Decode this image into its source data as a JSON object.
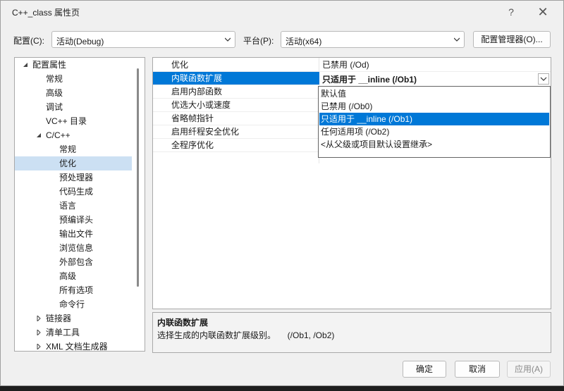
{
  "window": {
    "title": "C++_class 属性页",
    "help_glyph": "?",
    "close_glyph": "✕"
  },
  "toolbar": {
    "config_label": "配置(C):",
    "config_value": "活动(Debug)",
    "platform_label": "平台(P):",
    "platform_value": "活动(x64)",
    "config_manager_label": "配置管理器(O)..."
  },
  "tree": {
    "items": [
      {
        "label": "配置属性",
        "expander": "expanded"
      },
      {
        "label": "常规"
      },
      {
        "label": "高级"
      },
      {
        "label": "调试"
      },
      {
        "label": "VC++ 目录"
      },
      {
        "label": "C/C++",
        "expander": "expanded"
      },
      {
        "label": "常规"
      },
      {
        "label": "优化",
        "selected": true
      },
      {
        "label": "预处理器"
      },
      {
        "label": "代码生成"
      },
      {
        "label": "语言"
      },
      {
        "label": "预编译头"
      },
      {
        "label": "输出文件"
      },
      {
        "label": "浏览信息"
      },
      {
        "label": "外部包含"
      },
      {
        "label": "高级"
      },
      {
        "label": "所有选项"
      },
      {
        "label": "命令行"
      },
      {
        "label": "链接器",
        "expander": "collapsed"
      },
      {
        "label": "清单工具",
        "expander": "collapsed"
      },
      {
        "label": "XML 文档生成器",
        "expander": "collapsed"
      }
    ]
  },
  "properties": {
    "rows": [
      {
        "name": "优化",
        "value": "已禁用 (/Od)"
      },
      {
        "name": "内联函数扩展",
        "value": "只适用于 __inline (/Ob1)",
        "selected": true
      },
      {
        "name": "启用内部函数",
        "value": ""
      },
      {
        "name": "优选大小或速度",
        "value": ""
      },
      {
        "name": "省略帧指针",
        "value": ""
      },
      {
        "name": "启用纤程安全优化",
        "value": ""
      },
      {
        "name": "全程序优化",
        "value": ""
      }
    ],
    "dropdown_options": [
      {
        "label": "默认值"
      },
      {
        "label": "已禁用 (/Ob0)"
      },
      {
        "label": "只适用于 __inline (/Ob1)",
        "highlighted": true
      },
      {
        "label": "任何适用项 (/Ob2)"
      },
      {
        "label": "<从父级或项目默认设置继承>"
      }
    ]
  },
  "description": {
    "title": "内联函数扩展",
    "text": "选择生成的内联函数扩展级别。     (/Ob1, /Ob2)"
  },
  "buttons": {
    "ok": "确定",
    "cancel": "取消",
    "apply": "应用(A)"
  },
  "colors": {
    "selection": "#0078d7",
    "tree_selection": "#cce0f3"
  }
}
